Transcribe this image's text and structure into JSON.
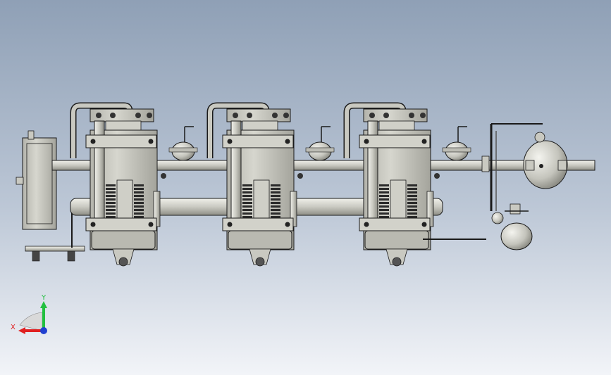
{
  "viewport": {
    "background_top": "#8fa0b6",
    "background_bottom": "#f2f4f8"
  },
  "triad": {
    "x_label": "X",
    "y_label": "Y",
    "x_color": "#e02020",
    "y_color": "#22c040",
    "z_color": "#2040d0"
  },
  "model": {
    "part_color": "#c9c9c1",
    "edge_color": "#1a1a1a",
    "fin_color": "#2b2b2b",
    "compressor_units": 3,
    "vessel_count": 2
  }
}
